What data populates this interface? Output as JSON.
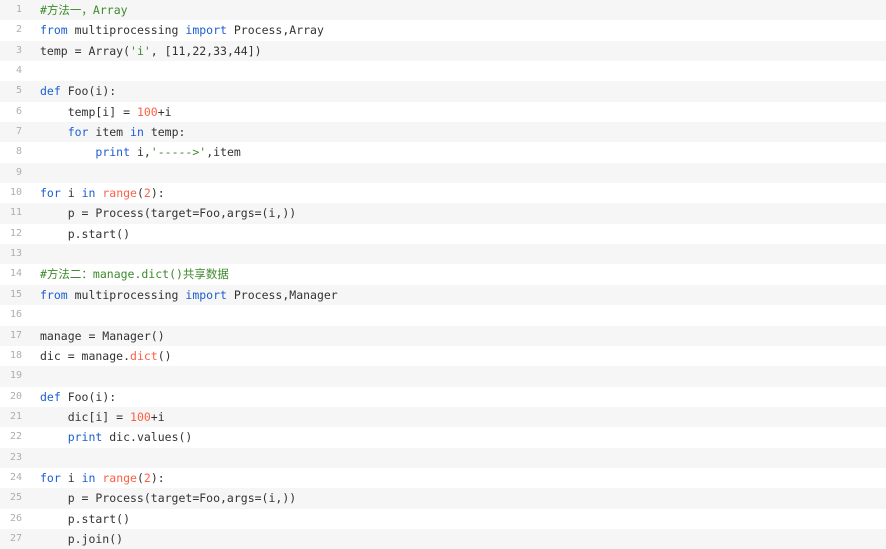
{
  "lines": [
    {
      "num": "1",
      "tokens": [
        {
          "t": "#方法一，Array",
          "c": "comment"
        }
      ]
    },
    {
      "num": "2",
      "tokens": [
        {
          "t": "from",
          "c": "kw"
        },
        {
          "t": " multiprocessing ",
          "c": "plain"
        },
        {
          "t": "import",
          "c": "kw"
        },
        {
          "t": " Process,Array",
          "c": "plain"
        }
      ]
    },
    {
      "num": "3",
      "tokens": [
        {
          "t": "temp = Array(",
          "c": "plain"
        },
        {
          "t": "'i'",
          "c": "str"
        },
        {
          "t": ", [11,22,33,44])",
          "c": "plain"
        }
      ]
    },
    {
      "num": "4",
      "tokens": []
    },
    {
      "num": "5",
      "tokens": [
        {
          "t": "def",
          "c": "kw"
        },
        {
          "t": " Foo(i):",
          "c": "plain"
        }
      ]
    },
    {
      "num": "6",
      "tokens": [
        {
          "t": "    temp[i] = ",
          "c": "plain"
        },
        {
          "t": "100",
          "c": "num"
        },
        {
          "t": "+i",
          "c": "plain"
        }
      ]
    },
    {
      "num": "7",
      "tokens": [
        {
          "t": "    ",
          "c": "plain"
        },
        {
          "t": "for",
          "c": "kw"
        },
        {
          "t": " item ",
          "c": "plain"
        },
        {
          "t": "in",
          "c": "kw"
        },
        {
          "t": " temp:",
          "c": "plain"
        }
      ]
    },
    {
      "num": "8",
      "tokens": [
        {
          "t": "        ",
          "c": "plain"
        },
        {
          "t": "print",
          "c": "kw"
        },
        {
          "t": " i,",
          "c": "plain"
        },
        {
          "t": "'----->'",
          "c": "str"
        },
        {
          "t": ",item",
          "c": "plain"
        }
      ]
    },
    {
      "num": "9",
      "tokens": []
    },
    {
      "num": "10",
      "tokens": [
        {
          "t": "for",
          "c": "kw"
        },
        {
          "t": " i ",
          "c": "plain"
        },
        {
          "t": "in",
          "c": "kw"
        },
        {
          "t": " ",
          "c": "plain"
        },
        {
          "t": "range",
          "c": "fn"
        },
        {
          "t": "(",
          "c": "plain"
        },
        {
          "t": "2",
          "c": "num"
        },
        {
          "t": "):",
          "c": "plain"
        }
      ]
    },
    {
      "num": "11",
      "tokens": [
        {
          "t": "    p = Process(target=Foo,args=(i,))",
          "c": "plain"
        }
      ]
    },
    {
      "num": "12",
      "tokens": [
        {
          "t": "    p.start()",
          "c": "plain"
        }
      ]
    },
    {
      "num": "13",
      "tokens": []
    },
    {
      "num": "14",
      "tokens": [
        {
          "t": "#方法二：manage.dict()共享数据",
          "c": "comment"
        }
      ]
    },
    {
      "num": "15",
      "tokens": [
        {
          "t": "from",
          "c": "kw"
        },
        {
          "t": " multiprocessing ",
          "c": "plain"
        },
        {
          "t": "import",
          "c": "kw"
        },
        {
          "t": " Process,Manager",
          "c": "plain"
        }
      ]
    },
    {
      "num": "16",
      "tokens": []
    },
    {
      "num": "17",
      "tokens": [
        {
          "t": "manage = Manager()",
          "c": "plain"
        }
      ]
    },
    {
      "num": "18",
      "tokens": [
        {
          "t": "dic = manage.",
          "c": "plain"
        },
        {
          "t": "dict",
          "c": "fn"
        },
        {
          "t": "()",
          "c": "plain"
        }
      ]
    },
    {
      "num": "19",
      "tokens": []
    },
    {
      "num": "20",
      "tokens": [
        {
          "t": "def",
          "c": "kw"
        },
        {
          "t": " Foo(i):",
          "c": "plain"
        }
      ]
    },
    {
      "num": "21",
      "tokens": [
        {
          "t": "    dic[i] = ",
          "c": "plain"
        },
        {
          "t": "100",
          "c": "num"
        },
        {
          "t": "+i",
          "c": "plain"
        }
      ]
    },
    {
      "num": "22",
      "tokens": [
        {
          "t": "    ",
          "c": "plain"
        },
        {
          "t": "print",
          "c": "kw"
        },
        {
          "t": " dic.values()",
          "c": "plain"
        }
      ]
    },
    {
      "num": "23",
      "tokens": []
    },
    {
      "num": "24",
      "tokens": [
        {
          "t": "for",
          "c": "kw"
        },
        {
          "t": " i ",
          "c": "plain"
        },
        {
          "t": "in",
          "c": "kw"
        },
        {
          "t": " ",
          "c": "plain"
        },
        {
          "t": "range",
          "c": "fn"
        },
        {
          "t": "(",
          "c": "plain"
        },
        {
          "t": "2",
          "c": "num"
        },
        {
          "t": "):",
          "c": "plain"
        }
      ]
    },
    {
      "num": "25",
      "tokens": [
        {
          "t": "    p = Process(target=Foo,args=(i,))",
          "c": "plain"
        }
      ]
    },
    {
      "num": "26",
      "tokens": [
        {
          "t": "    p.start()",
          "c": "plain"
        }
      ]
    },
    {
      "num": "27",
      "tokens": [
        {
          "t": "    p.join()",
          "c": "plain"
        }
      ]
    }
  ],
  "colors": {
    "keyword": "#1b5fd0",
    "comment": "#3d8b2c",
    "string": "#3d8b2c",
    "number": "#ff5f46",
    "builtin": "#ff5f46",
    "plain": "#333333",
    "gutter_text": "#aeaeae",
    "gutter_border": "#6ab85f",
    "stripe": "#f6f6f6"
  }
}
